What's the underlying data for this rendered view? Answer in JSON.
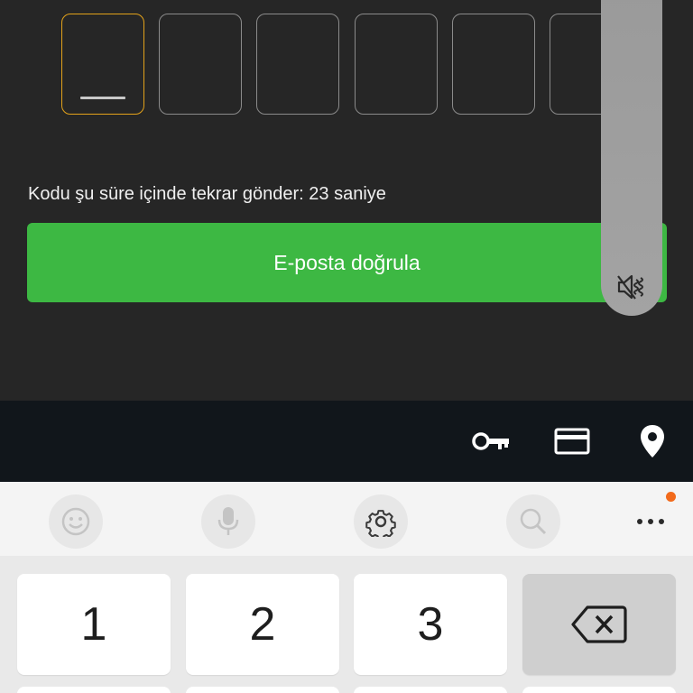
{
  "code_input": {
    "boxes": [
      "",
      "",
      "",
      "",
      "",
      ""
    ],
    "active_index": 0
  },
  "resend": {
    "text": "Kodu şu süre içinde tekrar gönder: 23 saniye"
  },
  "verify_button": {
    "label": "E-posta doğrula"
  },
  "volume_panel": {
    "icon": "volume-mute-icon"
  },
  "autofill_bar": {
    "icons": [
      "key-icon",
      "card-icon",
      "location-pin-icon"
    ]
  },
  "keyboard_toolbar": {
    "icons": [
      "emoji-icon",
      "microphone-icon",
      "settings-icon",
      "search-icon",
      "more-icon"
    ],
    "notification_dot_color": "#f26a1b"
  },
  "keyboard": {
    "keys": [
      "1",
      "2",
      "3"
    ],
    "backspace_icon": "backspace-icon"
  },
  "colors": {
    "background": "#262626",
    "accent_green": "#3db843",
    "active_box_border": "#e3a21a"
  }
}
